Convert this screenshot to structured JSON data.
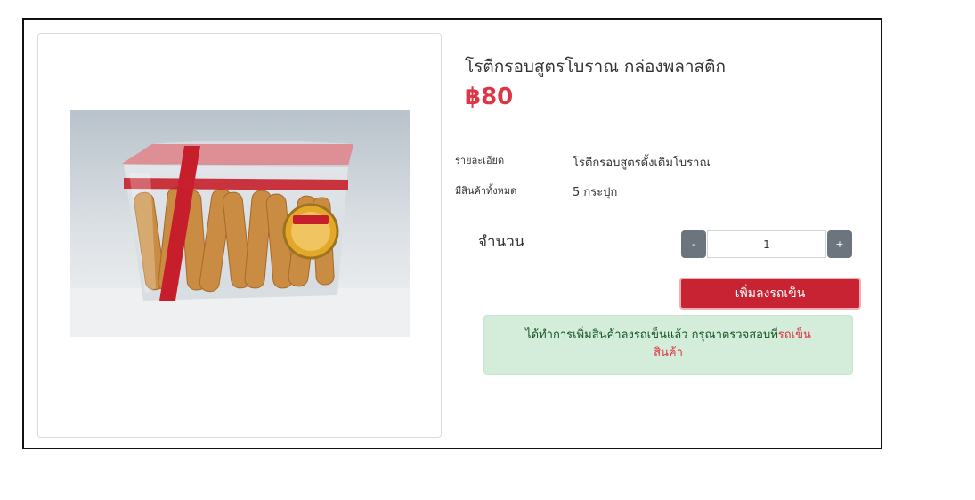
{
  "product": {
    "title": "โรตีกรอบสูตรโบราณ กล่องพลาสติก",
    "price": "฿80",
    "image_alt": "product-photo"
  },
  "details": {
    "description_label": "รายละเอียด",
    "description_value": "โรตีกรอบสูตรดั้งเดิมโบราณ",
    "stock_label": "มีสินค้าทั้งหมด",
    "stock_value": "5 กระปุก"
  },
  "quantity": {
    "label": "จำนวน",
    "minus_label": "-",
    "plus_label": "+",
    "value": "1"
  },
  "add_to_cart_label": "เพิ่มลงรถเข็น",
  "alert": {
    "text": "ได้ทำการเพิ่มสินค้าลงรถเข็นแล้ว กรุณาตรวจสอบที่",
    "link_text": "รถเข็นสินค้า"
  },
  "colors": {
    "price": "#dc3545",
    "button": "#c82333",
    "alert_bg": "#d4edda"
  }
}
